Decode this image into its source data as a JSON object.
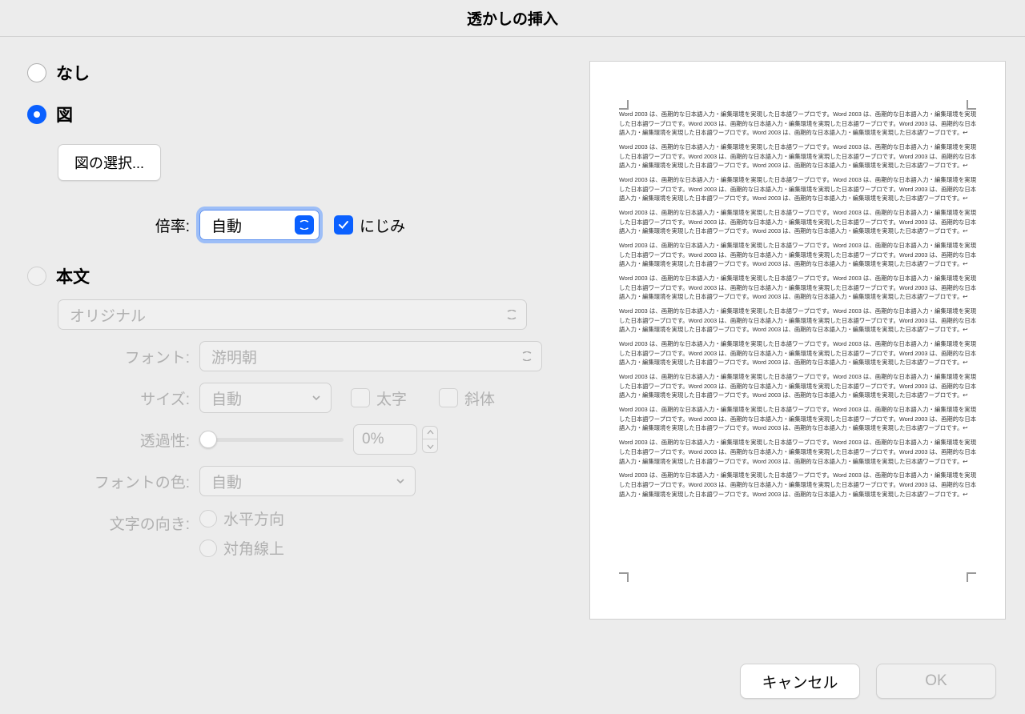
{
  "title": "透かしの挿入",
  "options": {
    "none": {
      "label": "なし",
      "selected": false
    },
    "picture": {
      "label": "図",
      "selected": true
    },
    "text": {
      "label": "本文",
      "selected": false
    }
  },
  "picture": {
    "select_button": "図の選択...",
    "scale_label": "倍率:",
    "scale_value": "自動",
    "washout_label": "にじみ",
    "washout_checked": true
  },
  "text": {
    "preset_value": "オリジナル",
    "font_label": "フォント:",
    "font_value": "游明朝",
    "size_label": "サイズ:",
    "size_value": "自動",
    "bold_label": "太字",
    "italic_label": "斜体",
    "transparency_label": "透過性:",
    "transparency_value": "0%",
    "font_color_label": "フォントの色:",
    "font_color_value": "自動",
    "orientation_label": "文字の向き:",
    "orientation_horizontal": "水平方向",
    "orientation_diagonal": "対角線上"
  },
  "preview": {
    "paragraph": "Word 2003 は、画期的な日本語入力・編集環境を実現した日本語ワープロです。Word 2003 は、画期的な日本語入力・編集環境を実現した日本語ワープロです。Word 2003 は、画期的な日本語入力・編集環境を実現した日本語ワープロです。Word 2003 は、画期的な日本語入力・編集環境を実現した日本語ワープロです。Word 2003 は、画期的な日本語入力・編集環境を実現した日本語ワープロです。↩",
    "repeat": 12
  },
  "footer": {
    "cancel": "キャンセル",
    "ok": "OK"
  }
}
